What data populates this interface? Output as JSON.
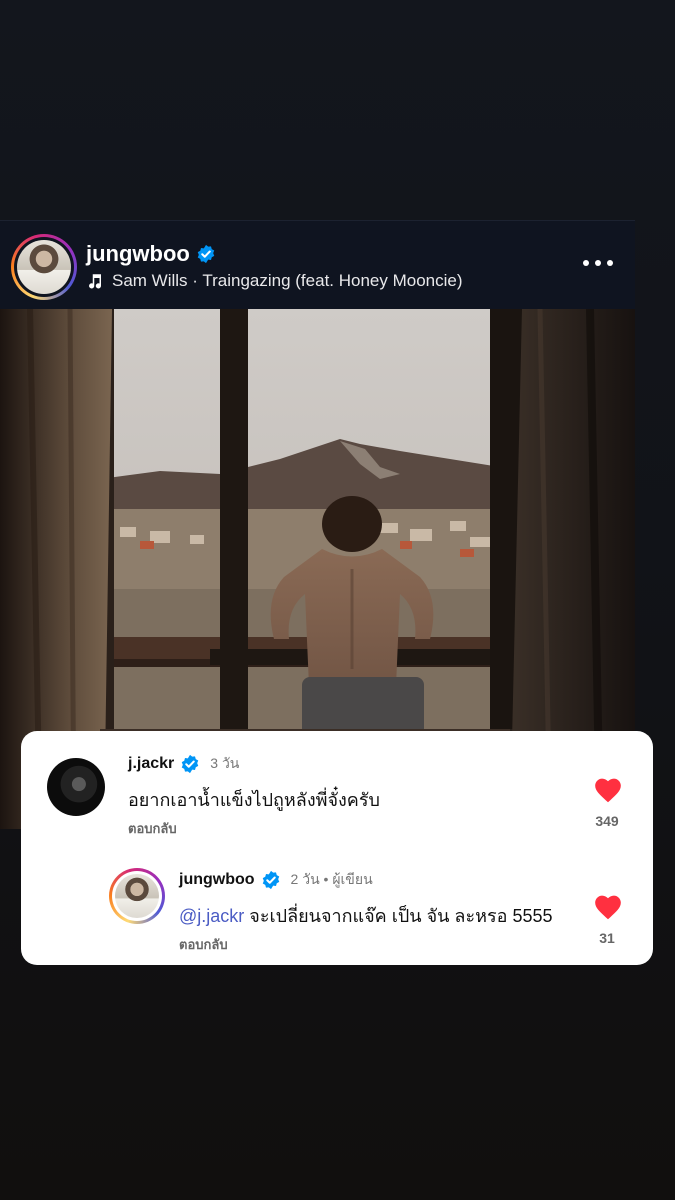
{
  "post": {
    "username": "jungwboo",
    "music": "Sam Wills · Traingazing (feat. Honey Mooncie)"
  },
  "comments": [
    {
      "username": "j.jackr",
      "time": "3 วัน",
      "text": "อยากเอาน้ำแข็งไปถูหลังพี่จั๋งครับ",
      "reply_label": "ตอบกลับ",
      "likes": "349"
    },
    {
      "username": "jungwboo",
      "time": "2 วัน • ผู้เขียน",
      "mention": "@j.jackr",
      "text": " จะเปลี่ยนจากแจ๊ค เป็น จัน ละหรอ 5555",
      "reply_label": "ตอบกลับ",
      "likes": "31"
    }
  ],
  "colors": {
    "heart": "#ff3040",
    "verified": "#0095f6",
    "mention": "#4b5cc4"
  }
}
